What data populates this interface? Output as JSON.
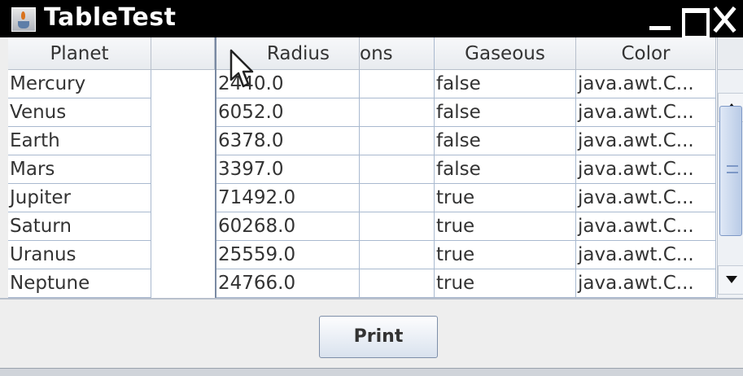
{
  "window": {
    "title": "TableTest"
  },
  "table": {
    "headers": {
      "planet": "Planet",
      "radius": "Radius",
      "moons_fragment": "ons",
      "gaseous": "Gaseous",
      "color": "Color"
    },
    "rows": [
      {
        "planet": "Mercury",
        "radius": "2440.0",
        "gaseous": "false",
        "color": "java.awt.C..."
      },
      {
        "planet": "Venus",
        "radius": "6052.0",
        "gaseous": "false",
        "color": "java.awt.C..."
      },
      {
        "planet": "Earth",
        "radius": "6378.0",
        "gaseous": "false",
        "color": "java.awt.C..."
      },
      {
        "planet": "Mars",
        "radius": "3397.0",
        "gaseous": "false",
        "color": "java.awt.C..."
      },
      {
        "planet": "Jupiter",
        "radius": "71492.0",
        "gaseous": "true",
        "color": "java.awt.C..."
      },
      {
        "planet": "Saturn",
        "radius": "60268.0",
        "gaseous": "true",
        "color": "java.awt.C..."
      },
      {
        "planet": "Uranus",
        "radius": "25559.0",
        "gaseous": "true",
        "color": "java.awt.C..."
      },
      {
        "planet": "Neptune",
        "radius": "24766.0",
        "gaseous": "true",
        "color": "java.awt.C..."
      }
    ]
  },
  "buttons": {
    "print": "Print"
  },
  "icons": {
    "app": "java-cup-icon",
    "minimize": "minimize-icon",
    "maximize": "maximize-icon",
    "close": "close-icon",
    "scroll_up": "arrow-up-icon",
    "scroll_down": "arrow-down-icon",
    "cursor": "mouse-pointer-icon"
  },
  "colors": {
    "titlebar": "#000000",
    "grid": "#a9b9cf",
    "scroll_thumb": "#b9cbe6",
    "text": "#333333"
  }
}
